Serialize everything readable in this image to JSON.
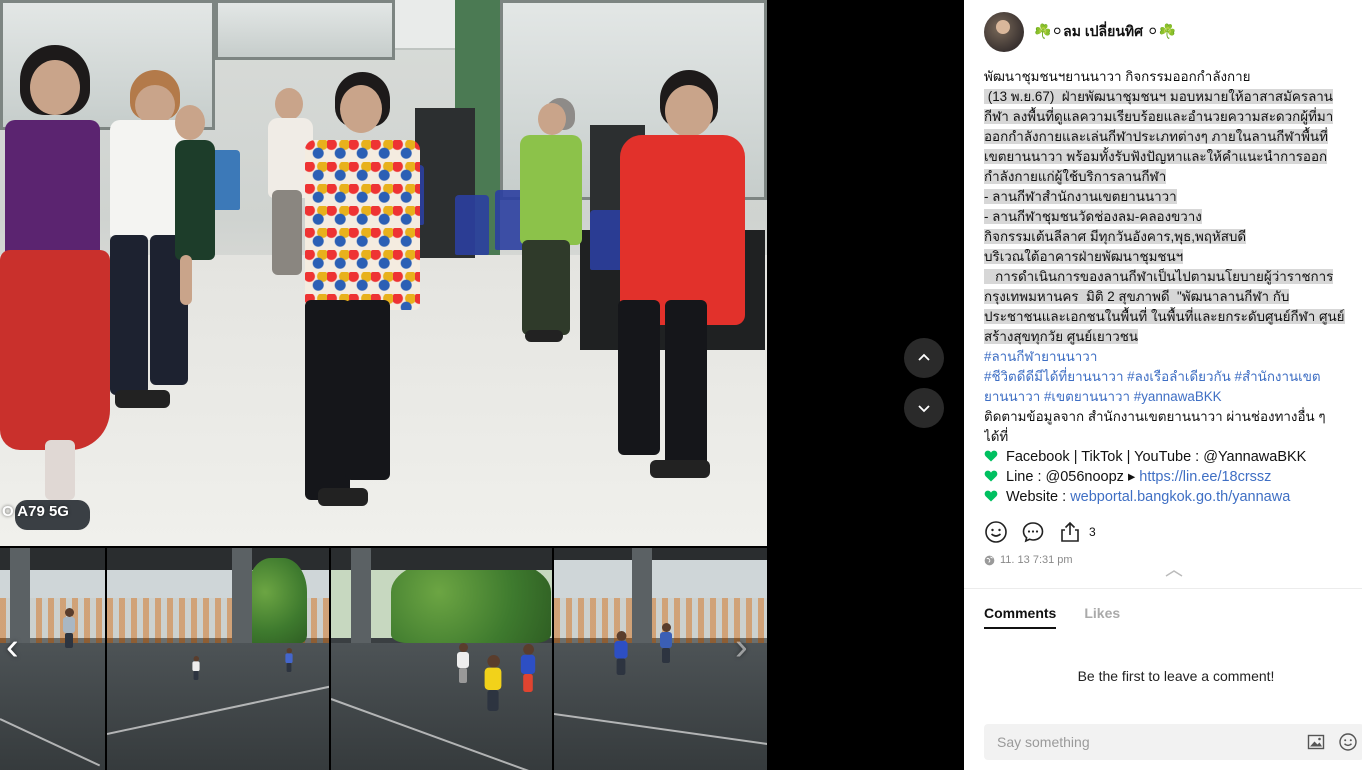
{
  "post": {
    "author": "☘️⚪ลม เปลี่ยนทิศ ⚪☘️",
    "lines": [
      {
        "text": "พัฒนาชุมชนฯยานนาวา กิจกรรมออกกำลังกาย",
        "style": "plain"
      },
      {
        "text": " (13 พ.ย.67)  ฝ่ายพัฒนาชุมชนฯ มอบหมายให้อาสาสมัครลาน",
        "style": "hl"
      },
      {
        "text": "กีฬา ลงพื้นที่ดูแลความเรียบร้อยและอำนวยความสะดวกผู้ที่มา",
        "style": "hl"
      },
      {
        "text": "ออกกำลังกายและเล่นกีฬาประเภทต่างๆ ภายในลานกีฬาพื้นที่",
        "style": "hl"
      },
      {
        "text": "เขตยานนาวา พร้อมทั้งรับฟังปัญหาและให้คำแนะนำการออก",
        "style": "hl"
      },
      {
        "text": "กำลังกายแก่ผู้ใช้บริการลานกีฬา",
        "style": "hl"
      },
      {
        "text": "- ลานกีฬาสำนักงานเขตยานนาวา",
        "style": "hl"
      },
      {
        "text": "- ลานกีฬาชุมชนวัดช่องลม-คลองขวาง",
        "style": "hl"
      },
      {
        "text": "กิจกรรมเต้นลีลาศ มีทุกวันอังคาร,พุธ,พฤหัสบดี",
        "style": "hl"
      },
      {
        "text": "บริเวณใต้อาคารฝ่ายพัฒนาชุมชนฯ",
        "style": "hl"
      },
      {
        "text": "   การดำเนินการของลานกีฬาเป็นไปตามนโยบายผู้ว่าราชการ",
        "style": "hl"
      },
      {
        "text": "กรุงเทพมหานคร  มิติ 2 สุขภาพดี  \"พัฒนาลานกีฬา กับ",
        "style": "hl"
      },
      {
        "text": "ประชาชนและเอกชนในพื้นที่ ในพื้นที่และยกระดับศูนย์กีฬา ศูนย์",
        "style": "hl"
      },
      {
        "text": "สร้างสุขทุกวัย ศูนย์เยาวชน",
        "style": "hl"
      },
      {
        "text": "#ลานกีฬายานนาวา",
        "style": "tag"
      },
      {
        "text": "#ชีวิตดีดีมีได้ที่ยานนาวา #ลงเรือลำเดียวกัน #สำนักงานเขต",
        "style": "tag"
      },
      {
        "text": "ยานนาวา #เขตยานนาวา #yannawaBKK",
        "style": "tag"
      },
      {
        "text": "ติดตามข้อมูลจาก สำนักงานเขตยานนาวา ผ่านช่องทางอื่น ๆ",
        "style": "plain"
      },
      {
        "text": "ได้ที่",
        "style": "plain"
      }
    ],
    "contacts": [
      {
        "label": "Facebook | TikTok | YouTube : @YannawaBKK",
        "link": ""
      },
      {
        "label": "Line : @056noopz ▸ ",
        "link": "https://lin.ee/18crssz"
      },
      {
        "label": "Website : ",
        "link": "webportal.bangkok.go.th/yannawa"
      }
    ],
    "share_count": "3",
    "timestamp": "11. 13 7:31 pm"
  },
  "media": {
    "watermark": "O A79 5G"
  },
  "comments": {
    "tabs": [
      "Comments",
      "Likes"
    ],
    "empty_text": "Be the first to leave a comment!",
    "placeholder": "Say something"
  },
  "icons": {
    "prev": "chevron-left-icon",
    "next": "chevron-right-icon",
    "up": "chevron-up-icon",
    "down": "chevron-down-icon",
    "heart": "green-heart-icon",
    "emoji": "smiley-icon",
    "comment": "comment-bubble-icon",
    "share": "share-icon",
    "globe": "globe-icon",
    "image": "image-icon"
  },
  "colors": {
    "hashtag": "#3f6fc4",
    "heart": "#00c060",
    "highlight": "#d7d7d7"
  }
}
